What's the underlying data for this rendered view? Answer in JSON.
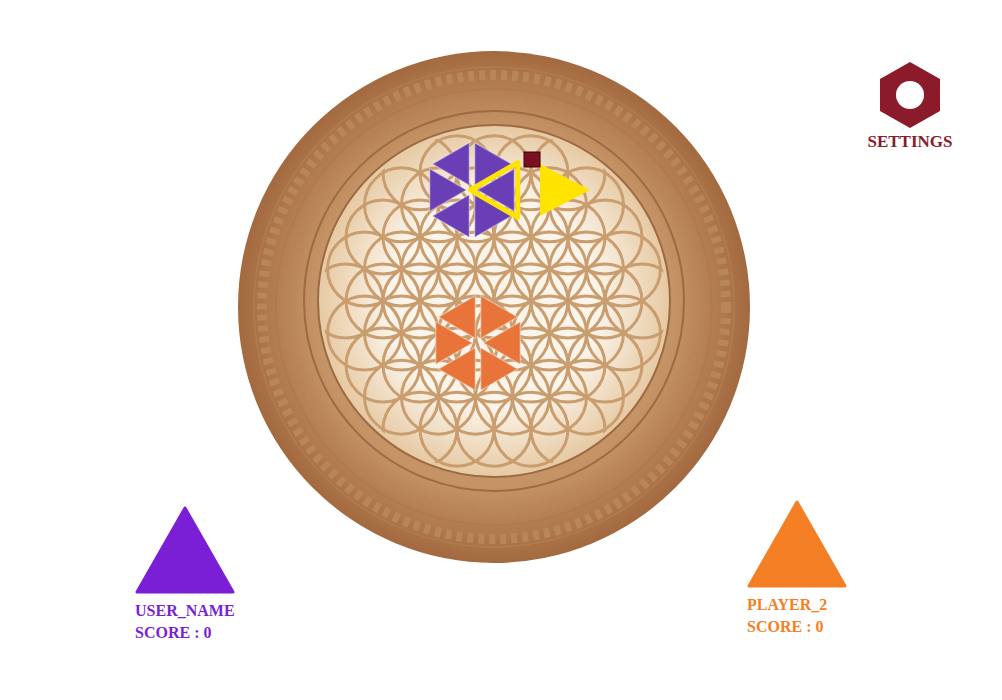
{
  "settings": {
    "label": "SETTINGS"
  },
  "players": [
    {
      "name": "USER_NAME",
      "score": "SCORE : 0",
      "color": "#7a1fd6",
      "piece_color": "#6a3fb5",
      "pieces": [
        {
          "selected": true
        },
        {
          "selected": false
        },
        {
          "selected": false
        },
        {
          "selected": false
        },
        {
          "selected": false
        },
        {
          "selected": false
        }
      ]
    },
    {
      "name": "PLAYER_2",
      "score": "SCORE : 0",
      "color": "#f47f24",
      "piece_color": "#e8743a",
      "pieces": [
        {
          "selected": false
        },
        {
          "selected": false
        },
        {
          "selected": false
        },
        {
          "selected": false
        },
        {
          "selected": false
        },
        {
          "selected": false
        }
      ]
    }
  ]
}
